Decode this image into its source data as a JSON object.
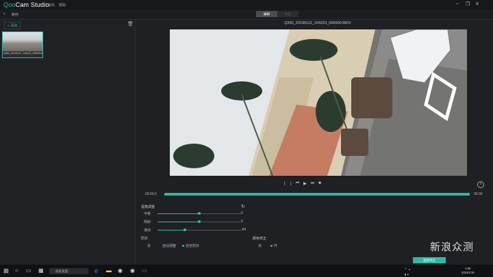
{
  "app": {
    "logo_prefix": "Qoo",
    "logo_suffix": "Cam Studio",
    "menu": [
      "退出",
      "帮助"
    ]
  },
  "nav": {
    "back_label": "<",
    "crumb": "制作"
  },
  "mode_tabs": [
    "编辑",
    "导出"
  ],
  "library": {
    "add_label": "+ 添加",
    "clip_name": "Q360_20190112_164223_000000.MOV"
  },
  "viewer": {
    "filename": "Q360_20190112_164223_000000.MOV"
  },
  "playback": {
    "start_time": "00:00.0",
    "end_time": "00:30",
    "progress": 0.0
  },
  "view_adjust": {
    "title": "视角调整",
    "sliders": [
      {
        "label": "平移",
        "value": "0",
        "fraction": 0.5
      },
      {
        "label": "倾斜",
        "value": "0",
        "fraction": 0.5
      },
      {
        "label": "滚动",
        "value": "-84",
        "fraction": 0.33
      }
    ]
  },
  "stabilization": {
    "title": "防抖",
    "options": [
      "关",
      "自动调整",
      "完全防抖"
    ],
    "selected": "完全防抖"
  },
  "color_correction": {
    "title": "颜色校正",
    "options": [
      "关",
      "开"
    ],
    "selected": "开"
  },
  "export_button": "直接导出",
  "taskbar": {
    "search_placeholder": "搜索桌面",
    "time": "2:08",
    "date": "2019/1/15"
  },
  "watermark": "新浪众测",
  "colors": {
    "accent": "#2fb8a5",
    "background": "#1e2023"
  }
}
